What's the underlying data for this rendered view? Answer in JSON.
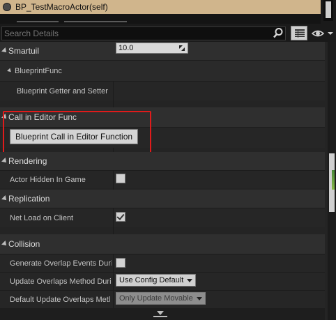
{
  "component": {
    "title": "BP_TestMacroActor(self)"
  },
  "search": {
    "placeholder": "Search Details"
  },
  "sections": {
    "smartuil": "Smartuil",
    "blueprint_func": "BlueprintFunc",
    "call_in_editor": "Call in Editor Func",
    "rendering": "Rendering",
    "replication": "Replication",
    "collision": "Collision"
  },
  "properties": {
    "getter_setter": {
      "label": "Blueprint Getter and Setter",
      "value": "10.0"
    },
    "call_button": "Blueprint Call in Editor Function",
    "actor_hidden": {
      "label": "Actor Hidden In Game",
      "checked": false
    },
    "net_load": {
      "label": "Net Load on Client",
      "checked": true
    },
    "gen_overlap": {
      "label": "Generate Overlap Events Duri",
      "checked": false
    },
    "update_overlaps": {
      "label": "Update Overlaps Method Duri",
      "value": "Use Config Default"
    },
    "default_update": {
      "label": "Default Update Overlaps Metl",
      "value": "Only Update Movable"
    }
  },
  "colors": {
    "highlight": "#e01b1b",
    "component_row": "#d0b58c"
  },
  "icons": {
    "search": "search-icon",
    "view_options": "eye-icon",
    "property_matrix": "grid-icon"
  }
}
